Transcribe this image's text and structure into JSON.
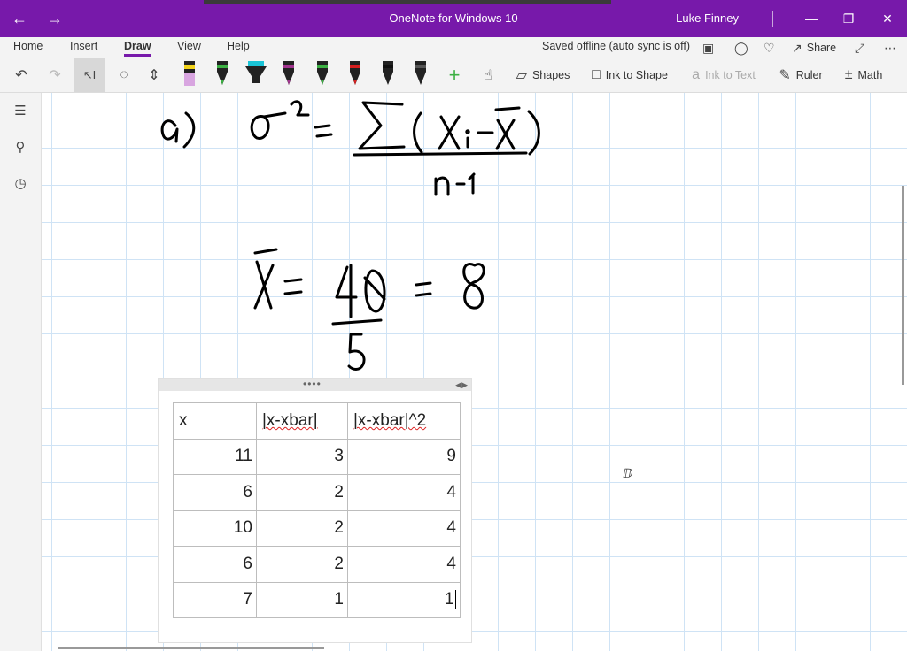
{
  "titlebar": {
    "app_title": "OneNote for Windows 10",
    "user": "Luke Finney",
    "back_icon": "arrow-left-icon",
    "forward_icon": "arrow-right-icon",
    "accent": "#7719aa"
  },
  "menu": {
    "items": [
      "Home",
      "Insert",
      "Draw",
      "View",
      "Help"
    ],
    "active": "Draw",
    "status": "Saved offline (auto sync is off)",
    "share_label": "Share"
  },
  "toolbar": {
    "shapes_label": "Shapes",
    "ink_to_shape_label": "Ink to Shape",
    "ink_to_text_label": "Ink to Text",
    "ruler_label": "Ruler",
    "math_label": "Math",
    "pens": [
      {
        "name": "yellow-highlighter",
        "color": "#f2d31a"
      },
      {
        "name": "green-pen",
        "color": "#3cb043"
      },
      {
        "name": "cyan-highlighter",
        "color": "#19c3d6"
      },
      {
        "name": "purple-pen",
        "color": "#a2358f"
      },
      {
        "name": "green-pen-2",
        "color": "#3cb043"
      },
      {
        "name": "red-pen",
        "color": "#d61f1f"
      },
      {
        "name": "black-pen",
        "color": "#111111"
      },
      {
        "name": "black-pen-2",
        "color": "#111111"
      }
    ]
  },
  "table": {
    "headers": [
      "x",
      "|x-xbar|",
      "|x-xbar|^2"
    ],
    "rows": [
      [
        "11",
        "3",
        "9"
      ],
      [
        "6",
        "2",
        "4"
      ],
      [
        "10",
        "2",
        "4"
      ],
      [
        "6",
        "2",
        "4"
      ],
      [
        "7",
        "1",
        "1"
      ]
    ]
  }
}
